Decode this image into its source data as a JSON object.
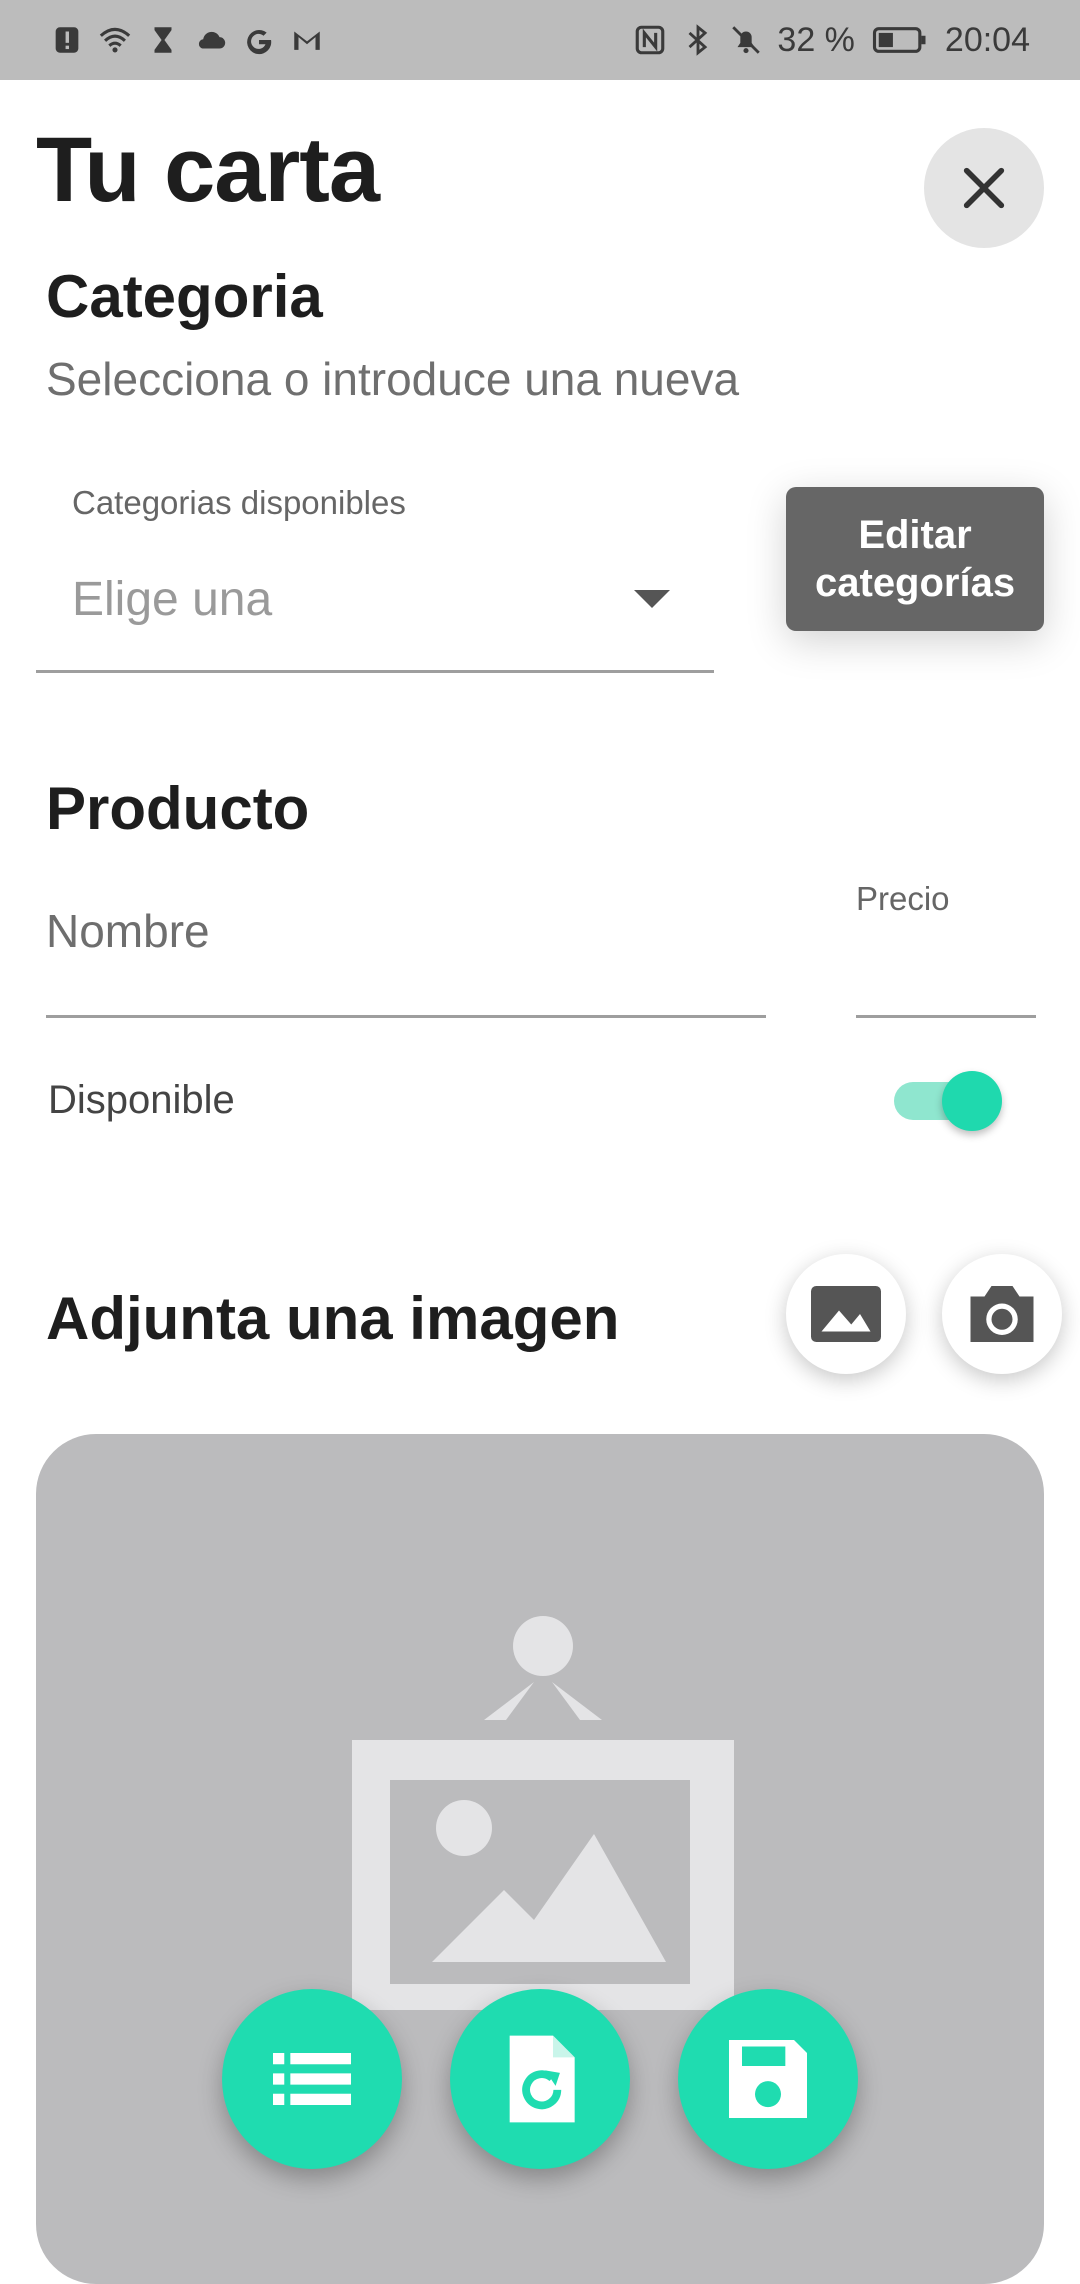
{
  "status_bar": {
    "battery_percent": "32 %",
    "time": "20:04",
    "left_icons": [
      "alert-icon",
      "wifi-icon",
      "hourglass-icon",
      "cloud-icon",
      "google-icon",
      "gmail-icon"
    ],
    "right_icons": [
      "nfc-icon",
      "bluetooth-icon",
      "mute-icon",
      "battery-icon"
    ]
  },
  "header": {
    "title": "Tu carta",
    "close_icon": "close-icon"
  },
  "categoria": {
    "title": "Categoria",
    "subtitle": "Selecciona o introduce una nueva",
    "dropdown_label": "Categorias disponibles",
    "dropdown_value": "Elige una",
    "edit_button_label": "Editar categorías"
  },
  "producto": {
    "title": "Producto",
    "name_placeholder": "Nombre",
    "price_label": "Precio",
    "available_label": "Disponible",
    "available": true
  },
  "imagen": {
    "title": "Adjunta una imagen",
    "gallery_icon": "gallery-icon",
    "camera_icon": "camera-icon",
    "placeholder_icon": "image-placeholder-icon"
  },
  "fabs": [
    "list-icon",
    "restore-file-icon",
    "save-icon"
  ],
  "colors": {
    "accent": "#1fdcb0",
    "status_bar": "#bcbcbc",
    "panel": "#bbbbbd",
    "edit_button": "#666666"
  }
}
